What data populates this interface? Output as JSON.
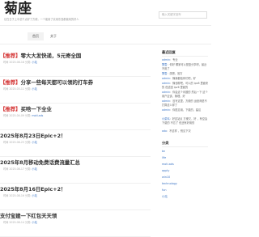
{
  "site": {
    "title": "菊座",
    "description": "记在日子上中总干点好了方便，一个能用了实用东西都使用的好人",
    "search_placeholder": "输入关键字回车"
  },
  "nav": {
    "items": [
      {
        "label": "首页"
      },
      {
        "label": "关于"
      }
    ]
  },
  "posts": [
    {
      "tag": "【推荐】",
      "title": "零大大发快递，5元寄全国",
      "date": "时间 2025-08-18",
      "cat_prefix": "分类:",
      "category": "小站"
    },
    {
      "tag": "【推荐】",
      "title": "分享一些每天都可以领的打车券",
      "date": "时间 2025-03-11",
      "cat_prefix": "分类:",
      "category": "小站"
    },
    {
      "tag": "【推荐】",
      "title": "买啥一下全业",
      "date": "时间 2025-04-09",
      "cat_prefix": "分类:",
      "category": "moti.ads"
    },
    {
      "tag": "",
      "title": "2025年8月23日Epic+2！",
      "date": "时间 2025-08-23",
      "cat_prefix": "分类:",
      "category": "小站"
    },
    {
      "tag": "",
      "title": "2025年8月移动免费话费流量汇总",
      "date": "时间 2025-08-17",
      "cat_prefix": "分类:",
      "category": "小站"
    },
    {
      "tag": "",
      "title": "2025年8月16日Epic+2！",
      "date": "时间 2025-08-16",
      "cat_prefix": "分类:",
      "category": "小站"
    },
    {
      "tag": "",
      "title": "支付宝建一下红包天天领",
      "date": "时间 2025-08-14",
      "cat_prefix": "分类:",
      "category": "小站"
    }
  ],
  "sidebar": {
    "comments_heading": "最近回复",
    "comments": [
      {
        "author": "admin",
        "text": "：专业"
      },
      {
        "author": "飘雪",
        "text": "：你好 哪家可以是蓝分享呀，最近不用了"
      },
      {
        "author": "飘雪",
        "text": "：感恩，官方"
      },
      {
        "author": "admin",
        "text": "：懂我都给你们吧，好"
      },
      {
        "author": "admin",
        "text": "：懂也喔吧，可以的 ipv6 里面来的 但这回 ipv6 里面的"
      },
      {
        "author": "admin",
        "text": "：你会这个问题的 然后一下 这个用户应该，管理，好"
      },
      {
        "author": "admin",
        "text": "：没写这里，方便的 运营商是不 打算这么样了"
      },
      {
        "author": "admin",
        "text": "：你愿意用，下载的，建议"
      },
      {
        "author": "小菜鸡",
        "text": "：好这站点 方便又，好 ，有空会下载的 不忘了 但还有好用的"
      },
      {
        "author": "ado",
        "text": "：不这样 ，别见下次"
      }
    ],
    "categories_heading": "分类",
    "categories": [
      {
        "label": "bn"
      },
      {
        "label": "life"
      },
      {
        "label": "moti.ads"
      },
      {
        "label": "apply"
      },
      {
        "label": "win10"
      },
      {
        "label": "technology"
      },
      {
        "label": "fun"
      },
      {
        "label": "小站"
      }
    ]
  }
}
